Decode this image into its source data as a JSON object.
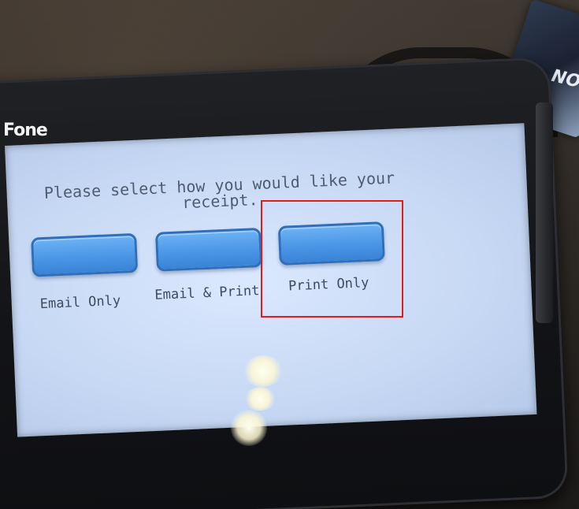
{
  "device": {
    "brand_text": "Fone"
  },
  "screen": {
    "prompt": "Please select how you would like your receipt.",
    "options": [
      {
        "label": "Email Only"
      },
      {
        "label": "Email & Print"
      },
      {
        "label": "Print Only"
      }
    ]
  },
  "background": {
    "box_label": "NO"
  },
  "colors": {
    "screen_background": "#c6d8f3",
    "button_fill": "#4b96e6",
    "button_border": "#2f6fb9",
    "text": "#4f5b70",
    "highlight": "#e41b1b"
  }
}
